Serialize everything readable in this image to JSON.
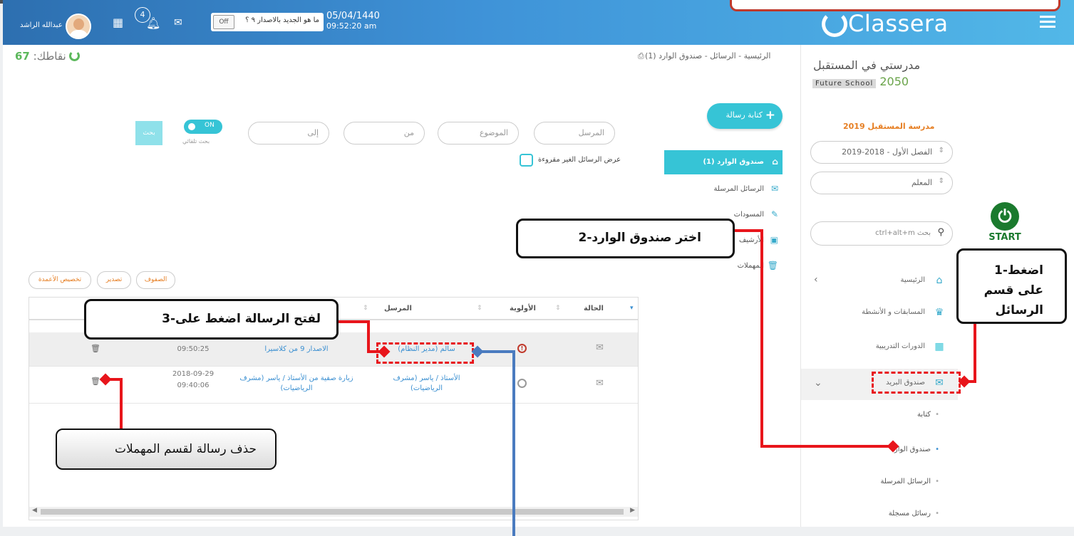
{
  "header": {
    "user_name": "عبدالله الراشد",
    "notif_count": "4",
    "whats_new": "ما هو الجديد بالاصدار ٩ ؟",
    "toggle_off": "Off",
    "date": "05/04/1440",
    "time": "09:52:20 am",
    "brand": "Classera"
  },
  "points": {
    "label": "نقاطك:",
    "value": "67"
  },
  "breadcrumb": "الرئيسية - الرسائل - صندوق الوارد (1)",
  "sidebar": {
    "school_name": "مدرستي في المستقبل",
    "future_school": "Future School",
    "future_year": "2050",
    "school_title": "مدرسة المستقبل 2019",
    "term_select": "الفصل الأول - 2018-2019",
    "role_select": "المعلم",
    "search_placeholder": "ctrl+alt+m بحث",
    "items": [
      {
        "label": "الرئيسية"
      },
      {
        "label": "المسابقات و الأنشطة"
      },
      {
        "label": "الدورات التدريبية"
      },
      {
        "label": "صندوق البريد"
      }
    ],
    "sub_items": [
      {
        "label": "كتابة"
      },
      {
        "label": "صندوق الوارد"
      },
      {
        "label": "الرسائل المرسلة"
      },
      {
        "label": "رسائل مسجلة"
      }
    ]
  },
  "start_badge": "START",
  "mail": {
    "compose": "كتابة رسالة",
    "nav": [
      {
        "label": "صندوق الوارد (1)"
      },
      {
        "label": "الرسائل المرسلة"
      },
      {
        "label": "المسودات"
      },
      {
        "label": "الأرشيف"
      },
      {
        "label": "المهملات"
      }
    ]
  },
  "filters": {
    "sender_placeholder": "المرسل",
    "subject_placeholder": "الموضوع",
    "from_placeholder": "من",
    "to_placeholder": "إلى",
    "toggle_on": "ON",
    "toggle_label": "بحث تلقائي",
    "search_button": "بحث",
    "unread_only": "عرض الرسائل الغير مقروءة"
  },
  "table_buttons": {
    "customize": "تخصيص الأعمدة",
    "export": "تصدير",
    "rows": "الصفوف"
  },
  "table": {
    "headers": {
      "status": "الحالة",
      "priority": "الأولوية",
      "sender": "المرسل"
    },
    "rows": [
      {
        "sender": "سالم (مدير النظام)",
        "subject": "الاصدار 9 من كلاسيرا",
        "time": "09:50:25"
      },
      {
        "sender": "الأستاذ / ياسر (مشرف الرياضيات)",
        "subject": "زيارة صفية من الأستاذ / ياسر (مشرف الرياضيات)",
        "date": "2018-09-29",
        "time": "09:40:06"
      }
    ]
  },
  "annotations": {
    "step1": "1-اضغط على قسم الرسائل",
    "step2": "2-اختر صندوق الوارد",
    "step3": "3-لفتح الرسالة اضغط على",
    "delete_note": "حذف رسالة لقسم المهملات"
  }
}
